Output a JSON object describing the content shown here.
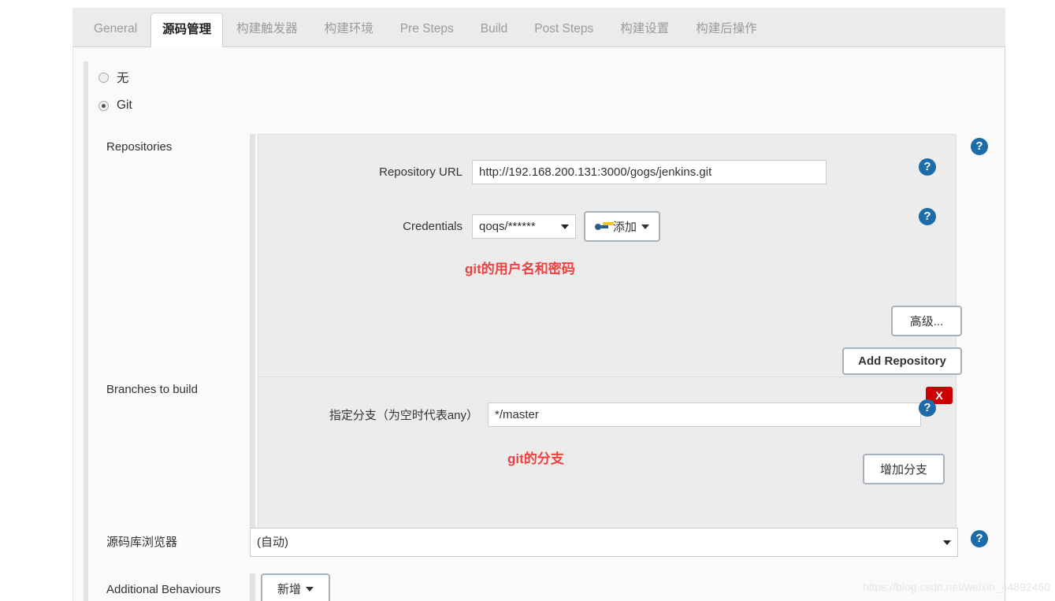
{
  "tabs": [
    {
      "label": "General",
      "active": false
    },
    {
      "label": "源码管理",
      "active": true
    },
    {
      "label": "构建触发器",
      "active": false
    },
    {
      "label": "构建环境",
      "active": false
    },
    {
      "label": "Pre Steps",
      "active": false
    },
    {
      "label": "Build",
      "active": false
    },
    {
      "label": "Post Steps",
      "active": false
    },
    {
      "label": "构建设置",
      "active": false
    },
    {
      "label": "构建后操作",
      "active": false
    }
  ],
  "scm": {
    "options": [
      {
        "label": "无",
        "checked": false
      },
      {
        "label": "Git",
        "checked": true
      }
    ]
  },
  "repositories": {
    "section_label": "Repositories",
    "url_label": "Repository URL",
    "url_value": "http://192.168.200.131:3000/gogs/jenkins.git",
    "credentials_label": "Credentials",
    "credentials_value": "qoqs/******",
    "add_credentials_button": "添加",
    "advanced_button": "高级...",
    "add_repository_button": "Add Repository",
    "annotation": "git的用户名和密码",
    "help_symbol": "?"
  },
  "branches": {
    "section_label": "Branches to build",
    "branch_label": "指定分支（为空时代表any）",
    "branch_value": "*/master",
    "delete_label": "X",
    "add_branch_button": "增加分支",
    "annotation": "git的分支",
    "help_symbol": "?"
  },
  "repo_browser": {
    "section_label": "源码库浏览器",
    "value": "(自动)",
    "help_symbol": "?"
  },
  "additional_behaviours": {
    "section_label": "Additional Behaviours",
    "add_button": "新增"
  },
  "watermark": "https://blog.csdn.net/weixin_44892460"
}
